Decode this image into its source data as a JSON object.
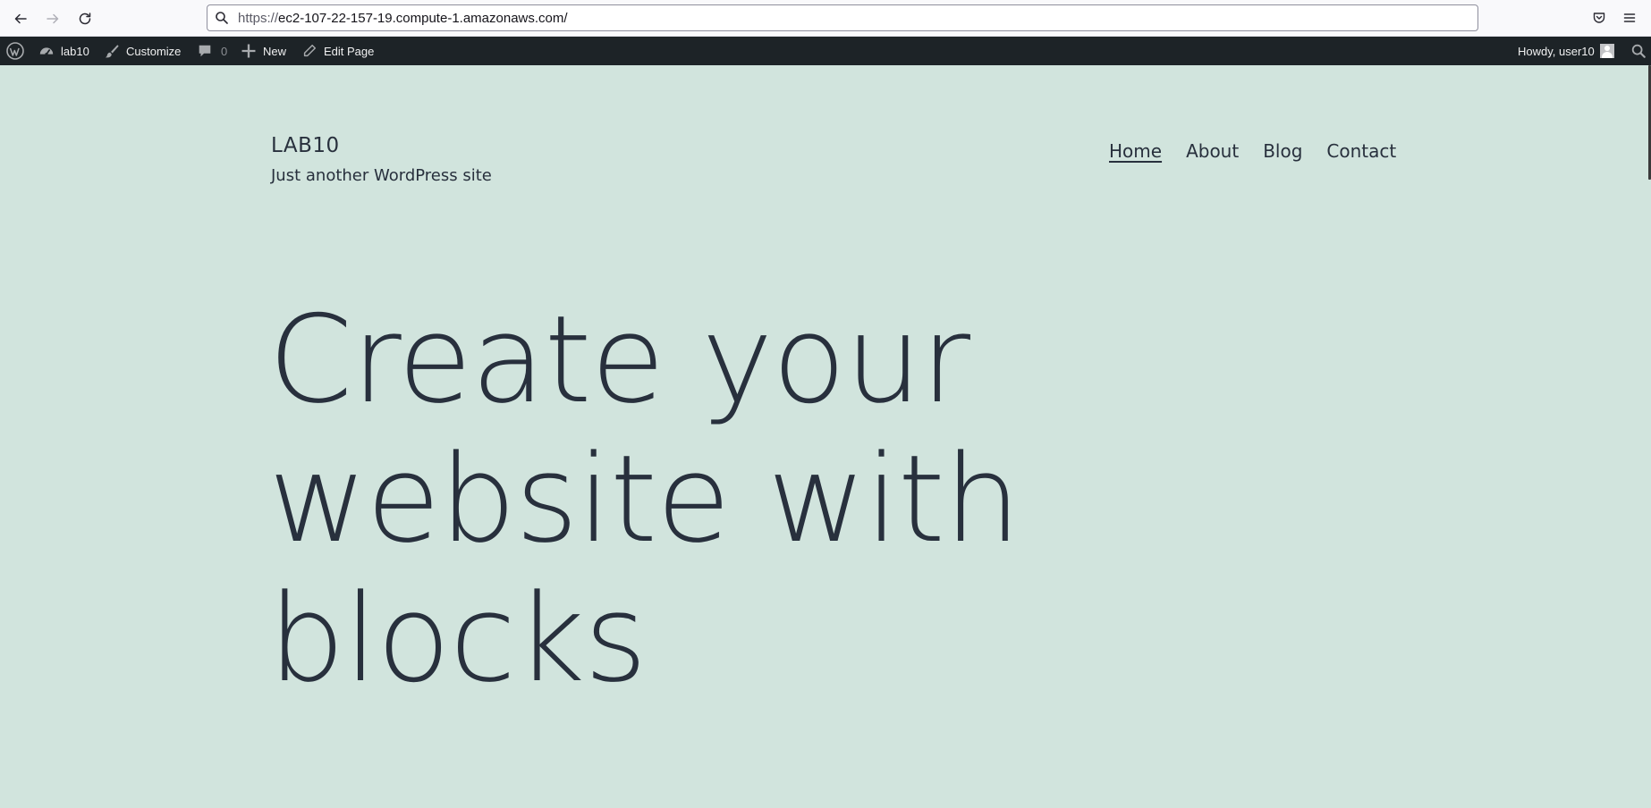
{
  "browser": {
    "url_scheme": "https://",
    "url_host": "ec2-107-22-157-19.compute-1.amazonaws.com",
    "url_path": "/"
  },
  "admin_bar": {
    "site_name": "lab10",
    "customize_label": "Customize",
    "comments_count": "0",
    "new_label": "New",
    "edit_page_label": "Edit Page",
    "greeting": "Howdy, user10"
  },
  "site": {
    "title": "LAB10",
    "description": "Just another WordPress site"
  },
  "nav": {
    "items": [
      {
        "label": "Home"
      },
      {
        "label": "About"
      },
      {
        "label": "Blog"
      },
      {
        "label": "Contact"
      }
    ]
  },
  "hero": {
    "line1": "Create your",
    "line2": "website with",
    "line3": "blocks"
  },
  "colors": {
    "page_background": "#d1e4dd",
    "text": "#28303d",
    "admin_bar": "#1d2327"
  }
}
